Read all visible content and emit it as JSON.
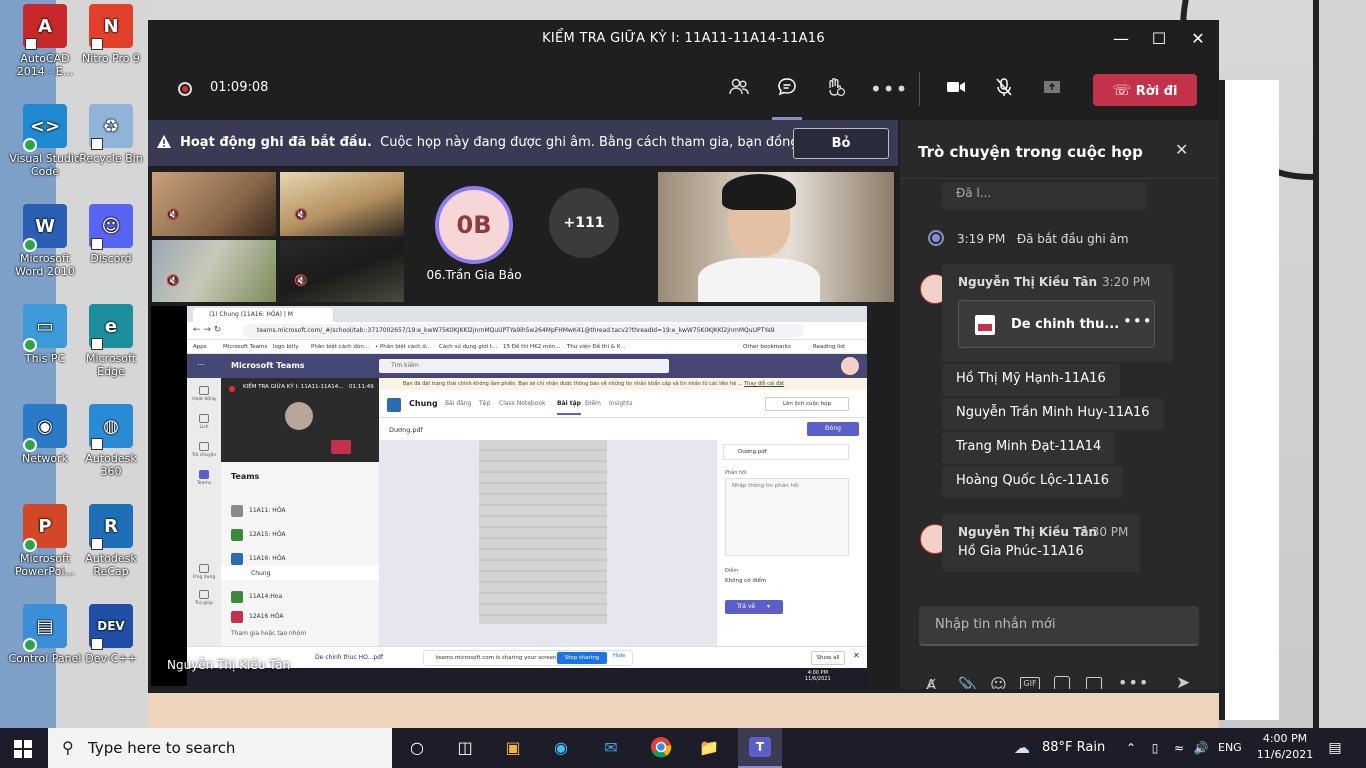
{
  "desktop": {
    "icons": [
      {
        "label": "AutoCAD 2014 - E...",
        "color": "#c8282a",
        "glyph": "A"
      },
      {
        "label": "Nitro Pro 9",
        "color": "#e2402c",
        "glyph": "N"
      },
      {
        "label": "Visual Studio Code",
        "color": "#1f8ad2",
        "glyph": "<>"
      },
      {
        "label": "Recycle Bin",
        "color": "#8fb4d8",
        "glyph": "♻"
      },
      {
        "label": "Microsoft Word 2010",
        "color": "#2b5fb4",
        "glyph": "W"
      },
      {
        "label": "Discord",
        "color": "#5865f2",
        "glyph": "☺"
      },
      {
        "label": "This PC",
        "color": "#3c9ad8",
        "glyph": "▭"
      },
      {
        "label": "Microsoft Edge",
        "color": "#1b8f9d",
        "glyph": "e"
      },
      {
        "label": "Network",
        "color": "#2a7ac8",
        "glyph": "◉"
      },
      {
        "label": "Autodesk 360",
        "color": "#2a8bd4",
        "glyph": "◍"
      },
      {
        "label": "Microsoft PowerPoi...",
        "color": "#d24726",
        "glyph": "P"
      },
      {
        "label": "Autodesk ReCap",
        "color": "#1e6fb8",
        "glyph": "R"
      },
      {
        "label": "Control Panel",
        "color": "#3a8fd8",
        "glyph": "▤"
      },
      {
        "label": "Dev-C++",
        "color": "#1f4fa6",
        "glyph": "DEV"
      }
    ]
  },
  "window": {
    "title": "KIỂM TRA GIỮA KỲ I: 11A11-11A14-11A16",
    "minimize_icon": "minimize-icon",
    "maximize_icon": "maximize-icon",
    "close_icon": "close-icon"
  },
  "toolbar": {
    "timer": "01:09:08",
    "leave_label": "Rời đi"
  },
  "banner": {
    "title": "Hoạt động ghi đã bắt đầu.",
    "message": "Cuộc họp này đang được ghi âm. Bằng cách tham gia, bạn đồng ...",
    "dismiss_label": "Bỏ"
  },
  "participants": {
    "avatar_initials": "0B",
    "avatar_name": "06.Trần Gia Bảo",
    "overflow_count": "+111",
    "presenter_name": "Nguyễn Thị Kiều Tân"
  },
  "shared_screen": {
    "tab_title": "(1) Chung (11A16: HÓA) | M",
    "url": "teams.microsoft.com/_#/school/tab::3717002657/19:e_kwW75K0KJKKl2jnrnMQuUPTYa9ih5w264MpFHMwK41@thread.tacv2?threadId=19:e_kwW75K0KJKKl2jnrnMQuUPTYa9",
    "bookmarks": [
      "Apps",
      "Microsoft Teams",
      "logo bitly",
      "Phân biệt cách dùn...",
      "• Phân biệt cách d...",
      "Cách sử dụng giới t...",
      "15 Đề thi HK2 môn...",
      "Thư viện Đề thi & K...",
      "Other bookmarks",
      "Reading list"
    ],
    "app_name": "Microsoft Teams",
    "search_placeholder": "Tìm kiếm",
    "notice": "Bạn đã đặt trạng thái chính không làm phiền. Bạn sẽ chỉ nhận được thông báo về những tin nhắn khẩn cấp và tin nhắn từ các liên hệ ...",
    "notice_link": "Thay đổi cài đặt",
    "meeting_title": "KIỂM TRA GIỮA KỲ I: 11A11-11A14...",
    "meeting_time": "01:11:49",
    "teams_label": "Teams",
    "team_rows": [
      "11A11: HÓA",
      "12A15: HÓA",
      "11A16: HÓA",
      "Chung",
      "11A14:Hoa",
      "12A16 HÓA"
    ],
    "join_label": "Tham gia hoặc tạo nhóm",
    "rail_items": [
      "Hoạt động",
      "Lịch",
      "Trò chuyện",
      "Teams",
      "Ứng dụng",
      "Trợ giúp"
    ],
    "channel_name": "Chung",
    "channel_tabs": [
      "Bài đăng",
      "Tệp",
      "Class Notebook",
      "Bài tập",
      "Điểm",
      "Insights"
    ],
    "schedule_label": "Lên lịch cuộc họp",
    "file_name": "Dương.pdf",
    "close_label": "Đóng",
    "feedback_label": "Phản hồi",
    "feedback_placeholder": "Nhập thông tin phản hồi",
    "grade_label": "Điểm",
    "grade_value": "Không có điểm",
    "return_label": "Trả về",
    "download_name": "De chinh thuc HO...pdf",
    "sharing_text": "teams.microsoft.com is sharing your screen.",
    "stop_sharing": "Stop sharing",
    "hide": "Hide",
    "show_all": "Show all",
    "inner_clock_time": "4:00 PM",
    "inner_clock_date": "11/6/2021"
  },
  "chat": {
    "title": "Trò chuyện trong cuộc họp",
    "truncated_top": "Đã l...",
    "system_time": "3:19 PM",
    "system_text": "Đã bắt đầu ghi âm",
    "messages": [
      {
        "sender": "Nguyễn Thị Kiều Tân",
        "time": "3:20 PM",
        "attachment": "De chinh thu...",
        "lines": [
          "Hồ Thị Mỹ Hạnh-11A16",
          "Nguyễn Trần Minh Huy-11A16",
          "Trang Minh Đạt-11A14",
          "Hoàng Quốc Lộc-11A16"
        ]
      },
      {
        "sender": "Nguyễn Thị Kiều Tân",
        "time": "3:30 PM",
        "lines": [
          "Hồ Gia Phúc-11A16"
        ]
      }
    ],
    "compose_placeholder": "Nhập tin nhắn mới"
  },
  "taskbar": {
    "search_placeholder": "Type here to search",
    "weather": "88°F  Rain",
    "language": "ENG",
    "time": "4:00 PM",
    "date": "11/6/2021"
  }
}
